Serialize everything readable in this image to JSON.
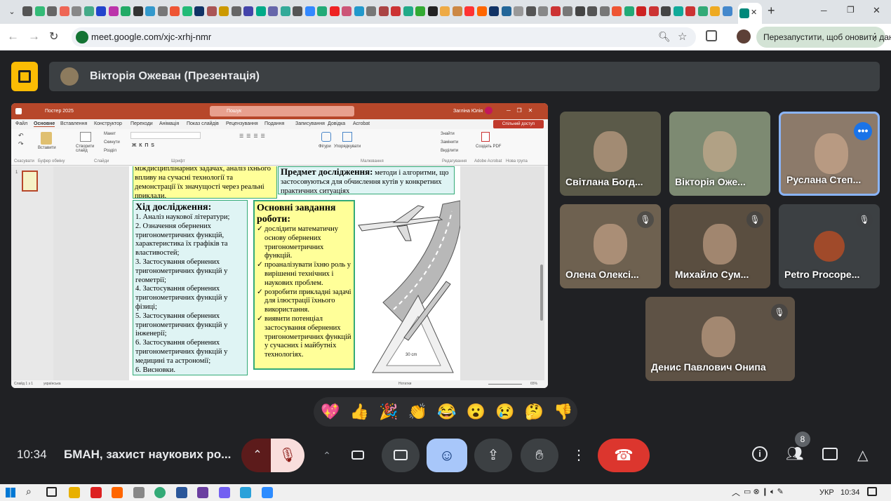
{
  "browser": {
    "url": "meet.google.com/xjc-xrhj-nmr",
    "restart_label": "Перезапустити, щоб оновити дані",
    "tab_close": "✕",
    "new_tab": "+"
  },
  "meet": {
    "presenter_label": "Вікторія Ожеван (Презентація)",
    "clock": "10:34",
    "meeting_title": "БМАН, захист наукових ро...",
    "participant_count": "8"
  },
  "powerpoint": {
    "search_placeholder": "Пошук",
    "file_title": "Постер 2025",
    "user_name": "Загліна Юлія",
    "share_button": "Спільний доступ",
    "menu": [
      "Файл",
      "Основне",
      "Вставлення",
      "Конструктор",
      "Переходи",
      "Анімація",
      "Показ слайдів",
      "Рецензування",
      "Подання",
      "Записування",
      "Довідка",
      "Acrobat"
    ],
    "ribbon": {
      "paste": "Вставити",
      "create_slide": "Створити слайд",
      "layout": "Макет",
      "reset": "Скинути",
      "section": "Розділ",
      "shapes": "Фігури",
      "arrange": "Упорядкувати",
      "find": "Знайти",
      "replace": "Замінити",
      "select": "Виділити",
      "create_pdf": "Создать PDF",
      "undo_group": "Скасувати",
      "clipboard_group": "Буфер обміну",
      "slides_group": "Слайди",
      "font_group": "Шрифт",
      "drawing_group": "Малювання",
      "editing_group": "Редагування",
      "acrobat_group": "Adobe Acrobat",
      "new_group": "Нова група"
    },
    "status": {
      "slide": "Слайд 1 з 1",
      "language": "українська",
      "notes": "Нотатки",
      "zoom": "65%"
    }
  },
  "slide": {
    "top_left_text": "міждисциплінарних задачах, аналіз їхнього впливу на сучасні технології та демонстрації їх значущості через реальні приклади.",
    "subject_title": "Предмет дослідження:",
    "subject_text": "методи і алгоритми, що застосовуються для обчислення кутів у конкретних практичних ситуаціях",
    "progress_title": "Хід дослідження:",
    "progress_items": [
      "1. Аналіз наукової літератури;",
      "2. Означення обернених тригонометричних функцій, характеристика їх графіків та властивостей;",
      "3. Застосування обернених тригонометричних функцій у геометрії;",
      "4. Застосування обернених тригонометричних функцій у фізиці;",
      "5. Застосування обернених тригонометричних функцій у інженерії;",
      "6. Застосування обернених тригонометричних функцій у медицині та астрономії;",
      "6. Висновки."
    ],
    "tasks_title": "Основні завдання роботи:",
    "tasks": [
      "дослідити математичну основу обернених тригонометричних функцій.",
      "проаналізувати їхню роль у вирішенні технічних і наукових проблем.",
      "розробити прикладні задачі для ілюстрації їхнього використання.",
      "виявити потенціал застосування обернених тригонометричних функцій у сучасних і майбутніх технологіях."
    ],
    "ruler_label": "30 cm"
  },
  "participants": [
    {
      "name": "Світлана Богд...",
      "muted": false
    },
    {
      "name": "Вікторія Оже...",
      "muted": false
    },
    {
      "name": "Руслана Степ...",
      "muted": false,
      "active": true
    },
    {
      "name": "Олена Олексі...",
      "muted": true
    },
    {
      "name": "Михайло Сум...",
      "muted": true
    },
    {
      "name": "Petro Procope...",
      "muted": true
    },
    {
      "name": "Денис Павлович Онипа",
      "muted": true
    }
  ],
  "reactions": [
    "💖",
    "👍",
    "🎉",
    "👏",
    "😂",
    "😮",
    "😢",
    "🤔",
    "👎"
  ],
  "taskbar": {
    "lang": "УКР",
    "time": "10:34"
  }
}
